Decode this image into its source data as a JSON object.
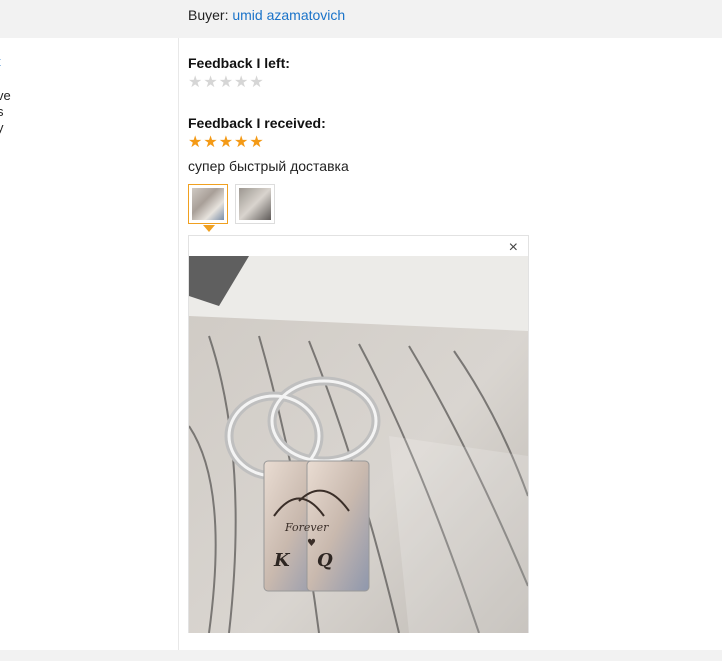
{
  "header": {
    "buyer_label": "Buyer:",
    "buyer_name": "umid azamatovich"
  },
  "left_panel": {
    "fragments": [
      "t",
      "ve",
      "s",
      "y"
    ]
  },
  "feedback_left": {
    "heading": "Feedback I left:",
    "stars_filled": 0,
    "stars_total": 5
  },
  "feedback_received": {
    "heading": "Feedback I received:",
    "stars_filled": 5,
    "stars_total": 5,
    "comment": "супер быстрый доставка"
  },
  "viewer": {
    "close_glyph": "×",
    "photo_text": {
      "brand": "Forever",
      "letter_left": "K",
      "letter_right": "Q"
    }
  },
  "colors": {
    "link": "#1a73c9",
    "star_full": "#f49a16",
    "star_empty": "#d6d6d6",
    "accent_border": "#f0a020"
  }
}
